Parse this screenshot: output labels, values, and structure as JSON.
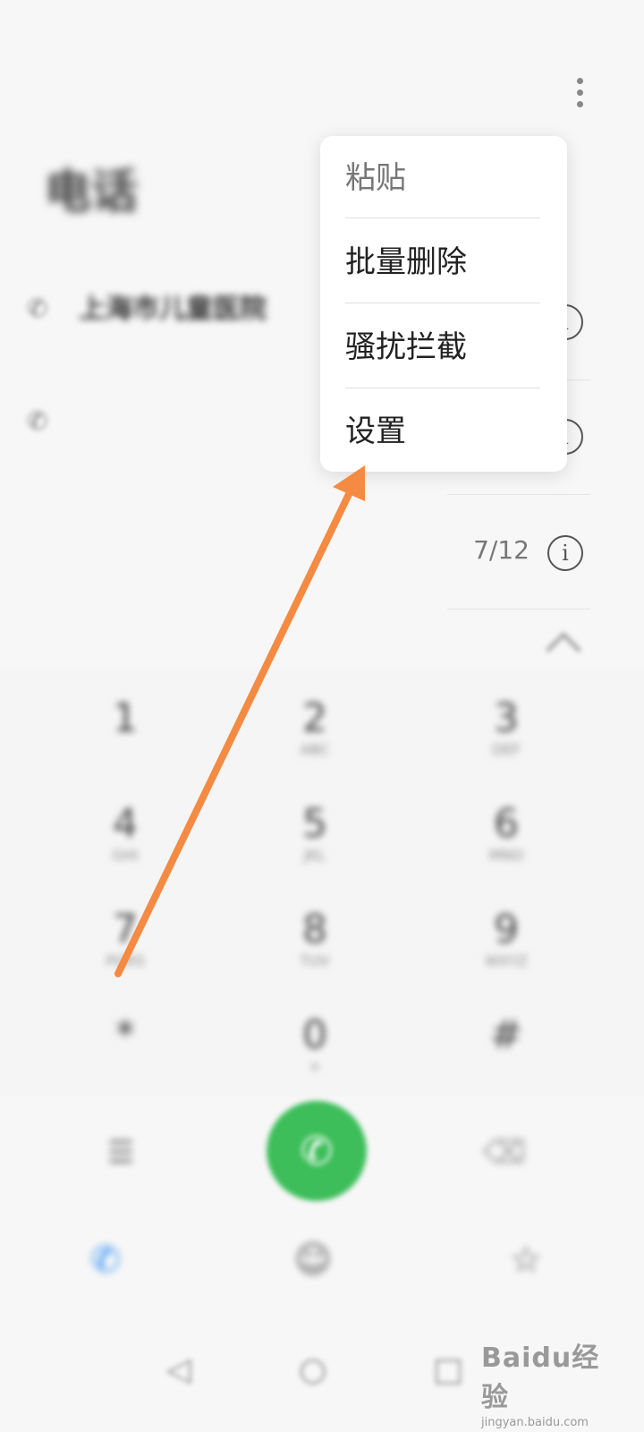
{
  "status_bar": {
    "left_text": "",
    "right_text": ""
  },
  "page": {
    "title": "电话"
  },
  "calls": [
    {
      "name": "上海市儿童医院",
      "sub": "",
      "date": ""
    },
    {
      "name": "",
      "sub": "",
      "date": ""
    },
    {
      "name": "",
      "sub": "",
      "date": "7/12"
    }
  ],
  "dialed_number": "",
  "dialpad": {
    "keys": [
      {
        "digit": "1",
        "letters": ""
      },
      {
        "digit": "2",
        "letters": "ABC"
      },
      {
        "digit": "3",
        "letters": "DEF"
      },
      {
        "digit": "4",
        "letters": "GHI"
      },
      {
        "digit": "5",
        "letters": "JKL"
      },
      {
        "digit": "6",
        "letters": "MNO"
      },
      {
        "digit": "7",
        "letters": "PQRS"
      },
      {
        "digit": "8",
        "letters": "TUV"
      },
      {
        "digit": "9",
        "letters": "WXYZ"
      },
      {
        "digit": "*",
        "letters": ""
      },
      {
        "digit": "0",
        "letters": "+"
      },
      {
        "digit": "#",
        "letters": ""
      }
    ]
  },
  "tabs": [
    {
      "label": "",
      "icon": "phone-icon",
      "active": true
    },
    {
      "label": "",
      "icon": "contacts-icon",
      "active": false
    },
    {
      "label": "",
      "icon": "favorites-icon",
      "active": false
    }
  ],
  "menu": {
    "items": [
      {
        "label": "粘贴",
        "enabled": false
      },
      {
        "label": "批量删除",
        "enabled": true
      },
      {
        "label": "骚扰拦截",
        "enabled": true
      },
      {
        "label": "设置",
        "enabled": true
      }
    ]
  },
  "watermark": {
    "logo": "Baidu经验",
    "sub": "jingyan.baidu.com"
  },
  "colors": {
    "dial_button": "#3dbe5a",
    "active_tab": "#2f8ef5",
    "annotation_arrow": "#f58a42"
  }
}
